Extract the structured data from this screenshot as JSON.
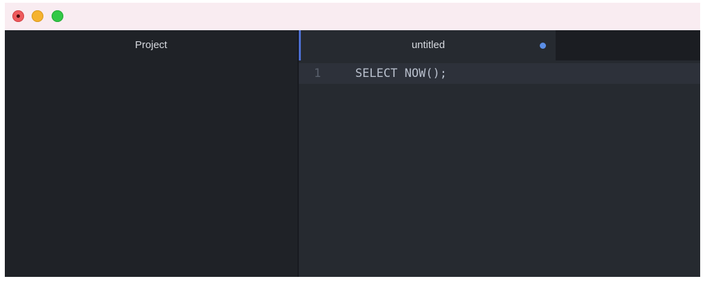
{
  "window": {
    "traffic_lights": [
      "close",
      "minimize",
      "zoom"
    ],
    "colors": {
      "close": "#ee5a5d",
      "minimize": "#f5b22f",
      "zoom": "#33c847",
      "titlebar": "#f9ecf1"
    }
  },
  "project_panel": {
    "title": "Project"
  },
  "editor": {
    "tabs": [
      {
        "title": "untitled",
        "modified": true
      }
    ],
    "lines": [
      {
        "number": "1",
        "text": "SELECT NOW();"
      }
    ],
    "colors": {
      "accent": "#4d6fd1",
      "modified_dot": "#5b8ee6"
    }
  }
}
